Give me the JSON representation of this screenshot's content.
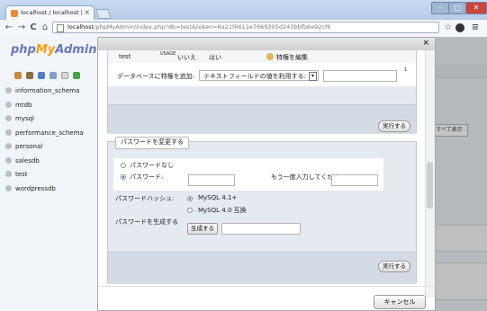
{
  "browser": {
    "tab_title": "localhost / localhost | php…",
    "tab_close": "×",
    "window_controls": {
      "minimize": "–",
      "maximize": "□",
      "close": "✕"
    },
    "url_host": "localhost",
    "url_rest": "/phpMyAdmin/index.php?db=test&token=6a21f6611e7669305d243bbfb6e92cf6",
    "nav_icons": [
      "back-arrow-icon",
      "forward-arrow-icon",
      "reload-icon",
      "home-icon"
    ],
    "nav_glyphs": {
      "back": "←",
      "forward": "→",
      "reload": "C",
      "home": "⌂",
      "star": "☆",
      "menu": "≡"
    }
  },
  "sidebar": {
    "logo": {
      "php": "php",
      "my": "My",
      "admin": "Admin"
    },
    "databases": [
      "information_schema",
      "mtdb",
      "mysql",
      "performance_schema",
      "personal",
      "salesdb",
      "test",
      "wordpressdb"
    ]
  },
  "background": {
    "button": "すべて表示"
  },
  "dialog": {
    "close": "×",
    "priv_row": {
      "db": "test",
      "usage": "USAGE",
      "grant": "いいえ",
      "other": "はい",
      "edit": "特権を編集"
    },
    "add_priv_label": "データベースに特権を追加:",
    "add_priv_select": "テキストフィールドの値を利用する:",
    "add_priv_select_arrow": "▾",
    "add_priv_superscript": "1",
    "go_button": "実行する",
    "password_legend": "パスワードを変更する",
    "no_password": "パスワードなし",
    "password_label": "パスワード:",
    "retype_label": "もう一度入力してください:",
    "hashing_label": "パスワードハッシュ:",
    "hash_options": [
      "MySQL 4.1+",
      "MySQL 4.0 互換"
    ],
    "generate_label": "パスワードを生成する",
    "generate_button": "生成する",
    "go_button2": "実行する",
    "cancel_button": "キャンセル"
  }
}
